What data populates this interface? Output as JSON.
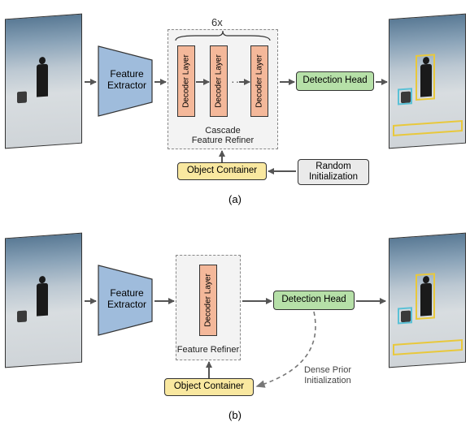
{
  "panel_a": {
    "input_image": "snow-scene-with-person",
    "output_image": "snow-scene-with-detections",
    "feature_extractor": "Feature\nExtractor",
    "decoder_count_label": "6x",
    "decoder_layer": "Decoder Layer",
    "refiner_caption": "Cascade\nFeature Refiner",
    "detection_head": "Detection Head",
    "object_container": "Object Container",
    "random_init": "Random\nInitialization",
    "label": "(a)"
  },
  "panel_b": {
    "input_image": "snow-scene-with-person",
    "output_image": "snow-scene-with-detections",
    "feature_extractor": "Feature\nExtractor",
    "decoder_layer": "Decoder Layer",
    "refiner_caption": "Feature Refiner",
    "detection_head": "Detection Head",
    "object_container": "Object Container",
    "dense_prior": "Dense Prior\nInitialization",
    "label": "(b)"
  },
  "colors": {
    "extractor": "#9fbcdc",
    "decoder": "#f4b89a",
    "detection": "#b6e0a8",
    "container": "#f9e8a0",
    "init": "#eaeaea"
  }
}
